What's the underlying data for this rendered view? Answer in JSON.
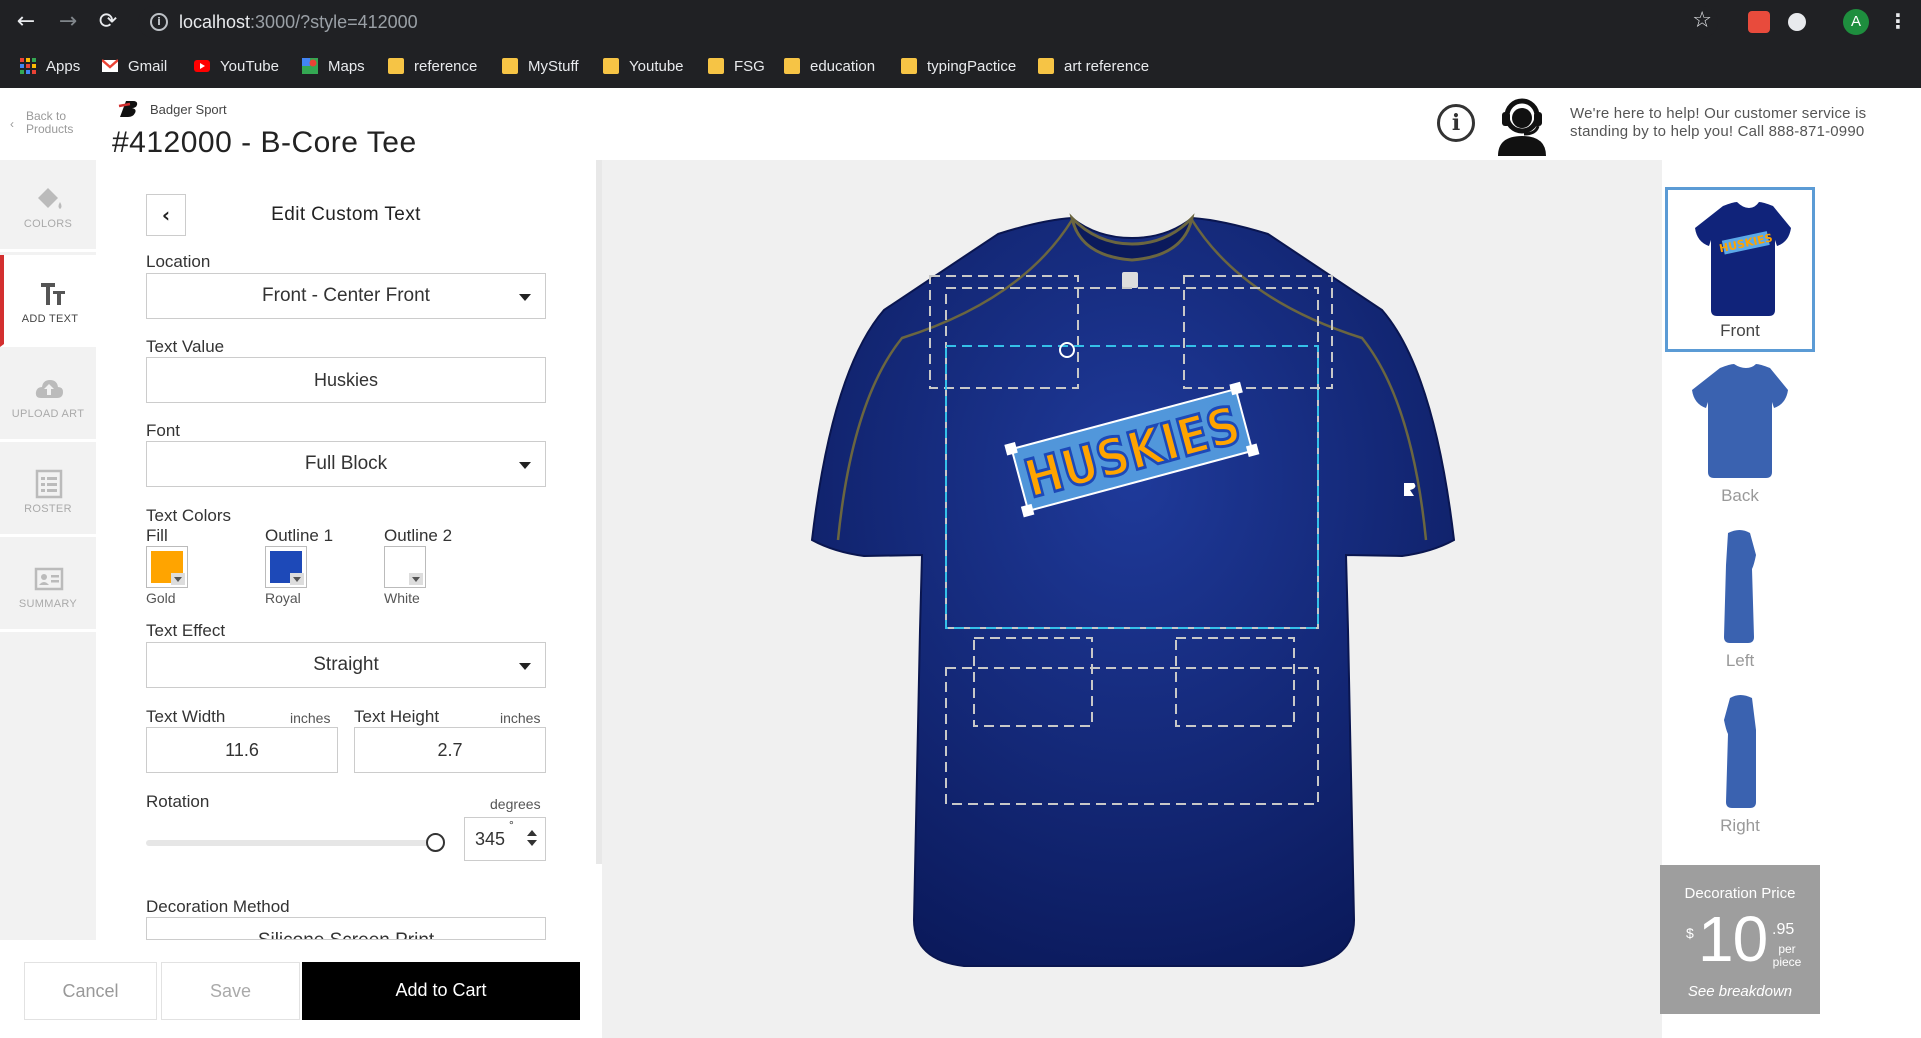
{
  "browser": {
    "url_host": "localhost",
    "url_rest": ":3000/?style=412000",
    "profile_initial": "A",
    "bookmarks": [
      "Apps",
      "Gmail",
      "YouTube",
      "Maps",
      "reference",
      "MyStuff",
      "Youtube",
      "FSG",
      "education",
      "typingPactice",
      "art reference"
    ]
  },
  "header": {
    "back_label": "Back to Products",
    "brand": "Badger Sport",
    "product_title": "#412000 - B-Core Tee",
    "help_line1": "We're here to help! Our customer service is",
    "help_line2": "standing by to help you! Call 888-871-0990"
  },
  "rail": {
    "items": [
      {
        "label": "COLORS",
        "icon": "paint-bucket-icon"
      },
      {
        "label": "ADD TEXT",
        "icon": "text-icon"
      },
      {
        "label": "UPLOAD ART",
        "icon": "cloud-upload-icon"
      },
      {
        "label": "ROSTER",
        "icon": "list-icon"
      },
      {
        "label": "SUMMARY",
        "icon": "id-card-icon"
      }
    ],
    "active": "ADD TEXT"
  },
  "editor": {
    "title": "Edit Custom Text",
    "location_label": "Location",
    "location_value": "Front - Center Front",
    "text_value_label": "Text Value",
    "text_value": "Huskies",
    "font_label": "Font",
    "font_value": "Full Block",
    "text_colors_label": "Text Colors",
    "fill_label": "Fill",
    "fill_color_name": "Gold",
    "fill_color": "#ffa400",
    "outline1_label": "Outline 1",
    "outline1_color_name": "Royal",
    "outline1_color": "#1d49b8",
    "outline2_label": "Outline 2",
    "outline2_color_name": "White",
    "outline2_color": "#ffffff",
    "text_effect_label": "Text Effect",
    "text_effect_value": "Straight",
    "text_width_label": "Text Width",
    "text_width_unit": "inches",
    "text_width_value": "11.6",
    "text_height_label": "Text Height",
    "text_height_unit": "inches",
    "text_height_value": "2.7",
    "rotation_label": "Rotation",
    "rotation_unit": "degrees",
    "rotation_value": "345",
    "rotation_symbol": "°",
    "decoration_label": "Decoration Method",
    "decoration_value": "Silicone Screen Print"
  },
  "actions": {
    "cancel": "Cancel",
    "save": "Save",
    "add_to_cart": "Add to Cart"
  },
  "canvas": {
    "design_text": "HUSKIES",
    "shirt_color": "#0f1f6e"
  },
  "views": {
    "items": [
      "Front",
      "Back",
      "Left",
      "Right"
    ],
    "active": "Front"
  },
  "price": {
    "title": "Decoration Price",
    "currency": "$",
    "dollars": "10",
    "cents": ".95",
    "unit": "per piece",
    "breakdown_link": "See breakdown"
  }
}
